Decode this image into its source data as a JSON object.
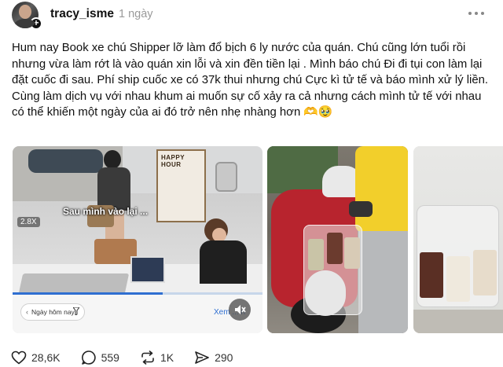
{
  "post": {
    "username": "tracy_isme",
    "time": "1 ngày",
    "text": "Hum nay Book xe chú Shipper lỡ làm đổ bịch 6 ly nước của quán. Chú cũng lớn tuổi rồi nhưng vừa làm rớt là vào quán xin lỗi và xin đền tiền lại . Mình báo chú Đi đi tụi con làm lại đặt cuốc đi sau. Phí ship cuốc xe có 37k thui nhưng chú Cực kì tử tế và báo mình xử lý liền.\nCùng làm dịch vụ với nhau khum ai muốn sự cố xảy ra cả nhưng cách mình tử tế với nhau có thể khiến một ngày của ai đó trở nên nhẹ nhàng hơn 🫶🥹"
  },
  "media": {
    "video": {
      "caption": "Sau mình vào lại ...",
      "speed": "2.8X",
      "poster_text": "HAPPY\nHOUR",
      "date_filter": "Ngày hôm nay",
      "view_link": "Xem ... n",
      "progress": 0.6
    }
  },
  "actions": {
    "likes": "28,6K",
    "comments": "559",
    "reposts": "1K",
    "shares": "290"
  },
  "colors": {
    "accent": "#2f6fd1",
    "text": "#101010",
    "muted": "#9a9a9a"
  },
  "icons": [
    "plus-icon",
    "more-icon",
    "filter-icon",
    "mute-icon",
    "heart-icon",
    "comment-icon",
    "repost-icon",
    "share-icon"
  ]
}
